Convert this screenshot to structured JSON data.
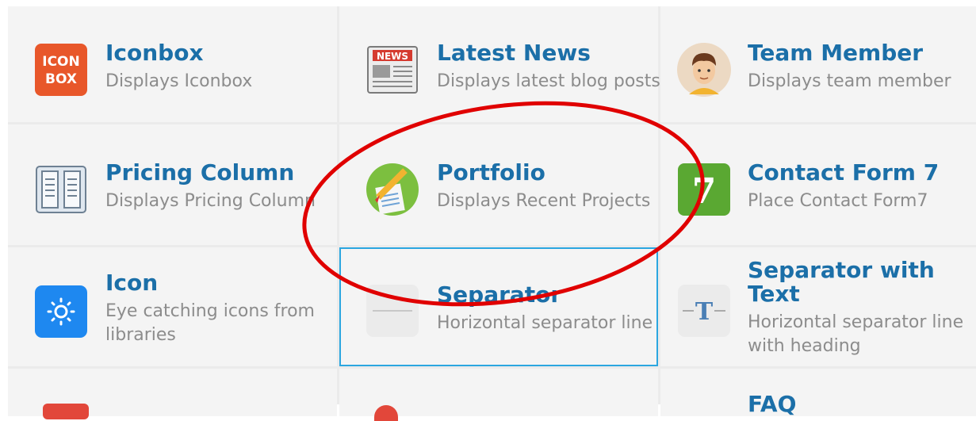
{
  "elements": [
    {
      "title": "Iconbox",
      "description": "Displays Iconbox",
      "icon": "iconbox-icon",
      "icon_text_1": "ICON",
      "icon_text_2": "BOX"
    },
    {
      "title": "Latest News",
      "description": "Displays latest blog posts",
      "icon": "newspaper-icon",
      "icon_text_1": "NEWS"
    },
    {
      "title": "Team Member",
      "description": "Displays team member",
      "icon": "person-avatar-icon"
    },
    {
      "title": "Pricing Column",
      "description": "Displays Pricing Column",
      "icon": "pricing-table-icon"
    },
    {
      "title": "Portfolio",
      "description": "Displays Recent Projects",
      "icon": "portfolio-pencil-icon"
    },
    {
      "title": "Contact Form 7",
      "description": "Place Contact Form7",
      "icon": "contact-form-7-icon",
      "icon_text_1": "7"
    },
    {
      "title": "Icon",
      "description": "Eye catching icons from libraries",
      "icon": "gear-icon"
    },
    {
      "title": "Separator",
      "description": "Horizontal separator line",
      "icon": "separator-line-icon",
      "selected": true
    },
    {
      "title": "Separator with Text",
      "description": "Horizontal separator line with heading",
      "icon": "separator-text-icon",
      "icon_text_1": "T"
    },
    {
      "title": "",
      "description": "",
      "icon": "red-icon"
    },
    {
      "title": "",
      "description": "",
      "icon": "red-round-icon"
    },
    {
      "title": "FAQ",
      "description": "",
      "icon": ""
    }
  ],
  "annotation": {
    "shape": "ellipse",
    "color": "#e00000"
  }
}
